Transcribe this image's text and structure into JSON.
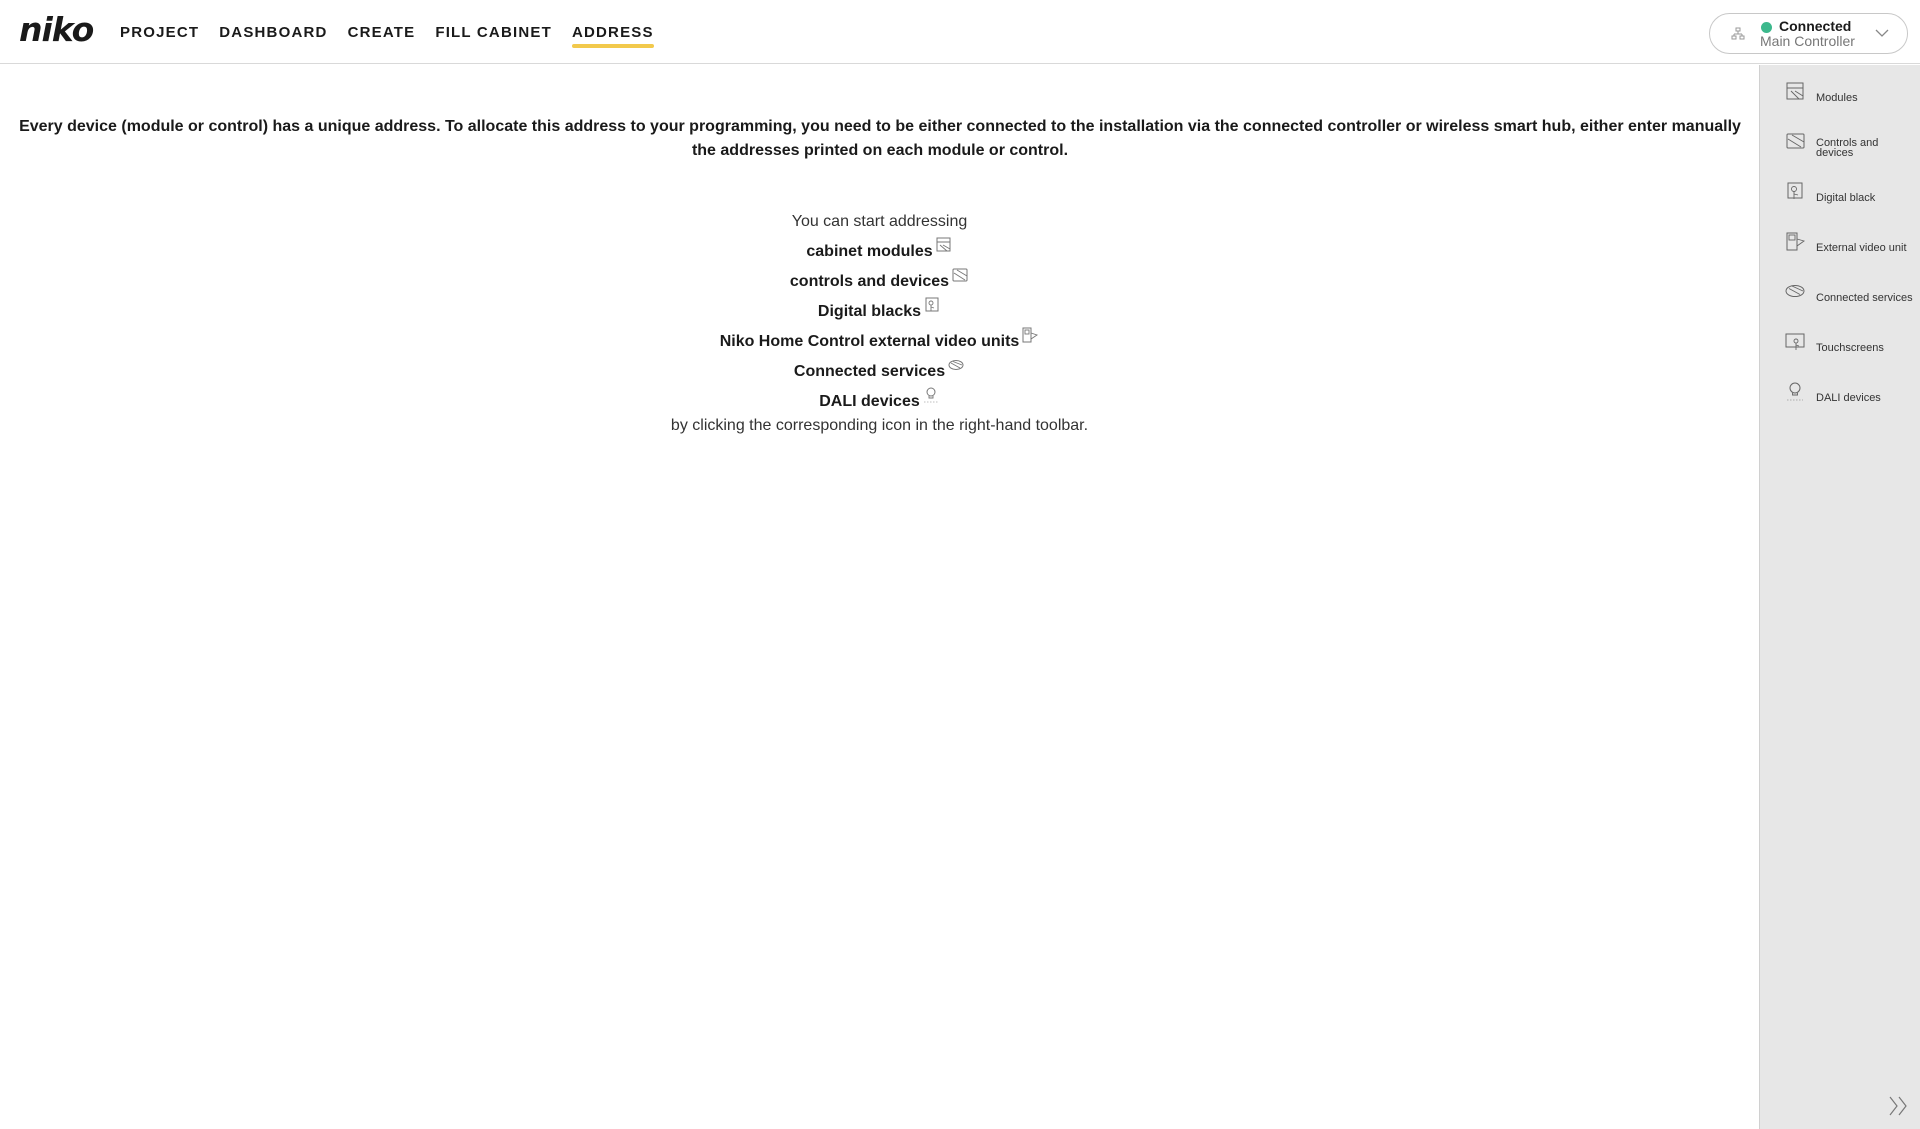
{
  "header": {
    "logo": "niko",
    "nav": [
      {
        "label": "PROJECT",
        "key": "project"
      },
      {
        "label": "DASHBOARD",
        "key": "dashboard"
      },
      {
        "label": "CREATE",
        "key": "create"
      },
      {
        "label": "FILL CABINET",
        "key": "fill-cabinet"
      },
      {
        "label": "ADDRESS",
        "key": "address"
      }
    ],
    "active_nav": "ADDRESS",
    "connection": {
      "status": "Connected",
      "name": "Main Controller",
      "status_color": "#3cb88c"
    }
  },
  "main": {
    "intro": "Every device (module or control) has a unique address. To allocate this address to your programming, you need to be either connected to the installation via the connected controller or wireless smart hub, either enter manually the addresses printed on each module or control.",
    "start_text": "You can start addressing",
    "items": [
      {
        "label": "cabinet modules",
        "icon": "modules-icon"
      },
      {
        "label": "controls and devices",
        "icon": "controls-icon"
      },
      {
        "label": "Digital blacks",
        "icon": "digital-black-icon"
      },
      {
        "label": "Niko Home Control external video units",
        "icon": "video-unit-icon"
      },
      {
        "label": "Connected services",
        "icon": "connected-services-icon"
      },
      {
        "label": "DALI devices",
        "icon": "dali-icon"
      }
    ],
    "end_text": "by clicking the corresponding icon in the right-hand toolbar."
  },
  "toolbar": {
    "items": [
      {
        "label": "Modules",
        "icon": "modules-icon"
      },
      {
        "label": "Controls and devices",
        "icon": "controls-icon"
      },
      {
        "label": "Digital black",
        "icon": "digital-black-icon"
      },
      {
        "label": "External video unit",
        "icon": "video-unit-icon"
      },
      {
        "label": "Connected services",
        "icon": "connected-services-icon"
      },
      {
        "label": "Touchscreens",
        "icon": "touchscreen-icon"
      },
      {
        "label": "DALI devices",
        "icon": "dali-icon"
      }
    ]
  },
  "colors": {
    "accent": "#f2c94c",
    "toolbar_bg": "#e7e7e7"
  }
}
